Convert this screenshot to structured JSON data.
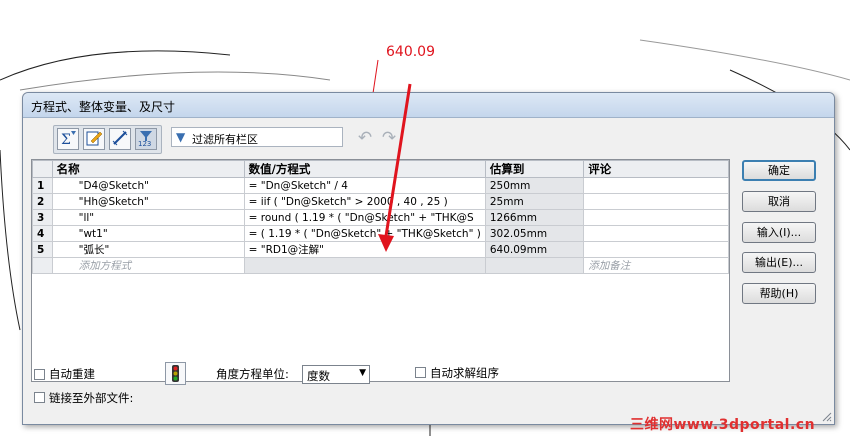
{
  "background": {
    "dimension_value": "640.09",
    "watermark": "三维网www.3dportal.cn"
  },
  "dialog": {
    "title": "方程式、整体变量、及尺寸",
    "toolbar": {
      "filter_text": "过滤所有栏区"
    },
    "table": {
      "headers": [
        "名称",
        "数值/方程式",
        "估算到",
        "评论"
      ],
      "rows": [
        {
          "num": "1",
          "name": "\"D4@Sketch\"",
          "value": "= \"Dn@Sketch\" / 4",
          "eval": "250mm",
          "comment": ""
        },
        {
          "num": "2",
          "name": "\"Hh@Sketch\"",
          "value": "= iif ( \"Dn@Sketch\" > 2000 , 40 , 25 )",
          "eval": "25mm",
          "comment": ""
        },
        {
          "num": "3",
          "name": "\"ll\"",
          "value": "= round ( 1.19 * ( \"Dn@Sketch\" + \"THK@S",
          "eval": "1266mm",
          "comment": ""
        },
        {
          "num": "4",
          "name": "\"wt1\"",
          "value": "= ( 1.19 * ( \"Dn@Sketch\" + \"THK@Sketch\" )",
          "eval": "302.05mm",
          "comment": ""
        },
        {
          "num": "5",
          "name": "\"弧长\"",
          "value": "= \"RD1@注解\"",
          "eval": "640.09mm",
          "comment": ""
        }
      ],
      "add_equation_placeholder": "添加方程式",
      "add_comment_placeholder": "添加备注"
    },
    "buttons": {
      "ok": "确定",
      "cancel": "取消",
      "import": "输入(I)...",
      "export": "输出(E)...",
      "help": "帮助(H)"
    },
    "options": {
      "auto_rebuild": "自动重建",
      "angle_unit_label": "角度方程单位:",
      "angle_unit_value": "度数",
      "auto_solve_order": "自动求解组序",
      "link_external": "链接至外部文件:"
    },
    "colors": {
      "accent_arrow": "#e0141e",
      "dialog_bg": "#f0f0f0"
    }
  }
}
